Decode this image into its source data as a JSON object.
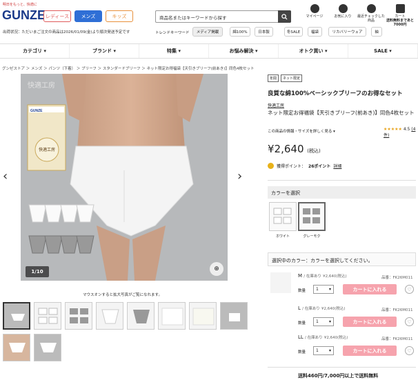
{
  "header": {
    "tagline": "明日をもっと、快適に",
    "logo": "GUNZE",
    "genders": [
      "レディース",
      "メンズ",
      "キッズ"
    ],
    "notice": "出荷状況：ただいまご注文の商品は2026/01/09(金)より順次発送予定です",
    "search_placeholder": "商品名またはキーワードから探す",
    "trend_label": "トレンドキーワード",
    "trends": [
      "メディア掲載",
      "綿100%",
      "日本製",
      "冬SALE",
      "福袋",
      "リカバリーウェア",
      "袖"
    ],
    "icons": [
      {
        "label": "マイページ",
        "icon": "person-icon"
      },
      {
        "label": "お気に入り",
        "icon": "heart-icon"
      },
      {
        "label": "最近チェックした商品",
        "icon": "check-icon"
      },
      {
        "label": "カート",
        "sub": "送料無料まであと7000円",
        "icon": "cart-icon"
      }
    ]
  },
  "nav": [
    "カテゴリ ▾",
    "ブランド ▾",
    "特集 ▾",
    "お悩み解決 ▾",
    "オトク買い ▾",
    "SALE ▾"
  ],
  "breadcrumb": "グンゼストア ＞ メンズ ＞ パンツ（下着） ＞ ブリーフ ＞ スタンダードブリーフ ＞ ネット限定お得福袋【天引きブリーフ(前あき)】同色4枚セット",
  "gallery": {
    "counter": "1/10",
    "caption": "マウスオンすると拡大写真がご覧になれます。",
    "package_text": "快適工房"
  },
  "product": {
    "tags": [
      "年間",
      "ネット限定"
    ],
    "headline": "良質な綿100%ベーシックブリーフのお得なセット",
    "brand": "快適工房",
    "name": "ネット限定お得福袋【天引きブリーフ(前あき)】同色4枚セット",
    "detail_link": "この商品の情報・サイズを詳しく見る ▾",
    "rating": "4.5",
    "reviews": "(4件)",
    "stars": "★★★★★",
    "price": "¥2,640",
    "tax": "(税込)",
    "points_label": "獲得ポイント：",
    "points": "26ポイント",
    "points_link": "詳細"
  },
  "color": {
    "heading": "カラーを選択",
    "options": [
      "ホワイト",
      "グレーモク"
    ],
    "selected_heading": "選択中のカラー：カラーを選択してください。"
  },
  "sizes": [
    {
      "size": "M",
      "stock": "/ 在庫あり",
      "price": "¥2,640",
      "tax": "(税込)",
      "code": "品番：FK26M011"
    },
    {
      "size": "L",
      "stock": "/ 在庫あり",
      "price": "¥2,640",
      "tax": "(税込)",
      "code": "品番：FK26M011"
    },
    {
      "size": "LL",
      "stock": "/ 在庫あり",
      "price": "¥2,640",
      "tax": "(税込)",
      "code": "品番：FK26M011"
    }
  ],
  "qty_label": "数量",
  "qty_value": "1",
  "cart_label": "カートに入れる",
  "shipping": "送料460円/7,000円以上で送料無料"
}
